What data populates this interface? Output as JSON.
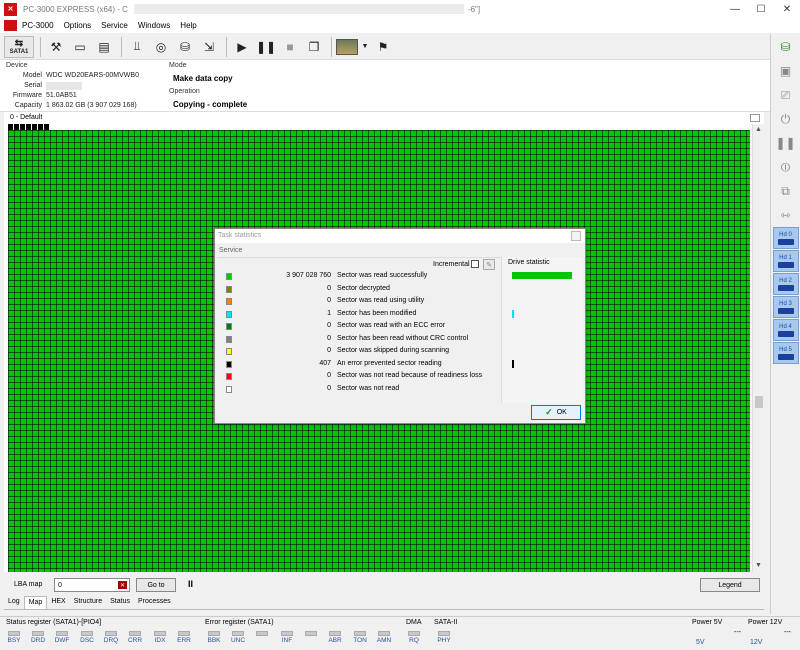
{
  "window": {
    "title": "PC-3000 EXPRESS (x64) - C",
    "title_tail": "-6\"]",
    "minimize": "—",
    "maximize": "☐",
    "close": "✕"
  },
  "menu": {
    "items": [
      "PC-3000",
      "Options",
      "Service",
      "Windows",
      "Help"
    ]
  },
  "toolbar": {
    "sata_label": "SATA1"
  },
  "device": {
    "section": "Device",
    "model_label": "Model",
    "model": "WDC WD20EARS-00MVWB0",
    "serial_label": "Serial",
    "firmware_label": "Firmware",
    "firmware": "51.0AB51",
    "capacity_label": "Capacity",
    "capacity": "1 863.02 GB (3 907 029 168)"
  },
  "mode": {
    "section": "Mode",
    "value": "Make data copy"
  },
  "operation": {
    "section": "Operation",
    "value": "Copying - complete"
  },
  "map": {
    "header": "0 - Default"
  },
  "lba": {
    "label": "LBA map",
    "value": "0",
    "goto": "Go to",
    "pause": "II",
    "legend": "Legend"
  },
  "tabs": [
    "Log",
    "Map",
    "HEX",
    "Structure",
    "Status",
    "Processes"
  ],
  "active_tab": "Map",
  "status": {
    "status_reg": "Status register (SATA1)-[PIO4]",
    "status_leds": [
      "BSY",
      "DRD",
      "DWF",
      "DSC",
      "DRQ",
      "CRR",
      "IDX",
      "ERR"
    ],
    "error_reg": "Error register (SATA1)",
    "error_leds": [
      "BBK",
      "UNC",
      "",
      "INF",
      "",
      "ABR",
      "TON",
      "AMN"
    ],
    "dma_label": "DMA",
    "dma_leds": [
      "RQ"
    ],
    "sata_label": "SATA-II",
    "sata_leds": [
      "PHY"
    ],
    "power5": "Power 5V",
    "power5_val": "5V",
    "power12": "Power 12V",
    "power12_val": "12V",
    "dash": "---"
  },
  "dialog": {
    "title": "Task statistics",
    "service": "Service",
    "incremental": "Incremental",
    "drive_statistic": "Drive statistic",
    "ok": "OK",
    "rows": [
      {
        "color": "#00c800",
        "count": "3 907 028 760",
        "desc": "Sector was read successfully"
      },
      {
        "color": "#808000",
        "count": "0",
        "desc": "Sector decrypted"
      },
      {
        "color": "#ff8000",
        "count": "0",
        "desc": "Sector was read using utility"
      },
      {
        "color": "#00e0ff",
        "count": "1",
        "desc": "Sector has been modified"
      },
      {
        "color": "#008000",
        "count": "0",
        "desc": "Sector was read with an ECC error"
      },
      {
        "color": "#808080",
        "count": "0",
        "desc": "Sector has been read without CRC control"
      },
      {
        "color": "#ffff00",
        "count": "0",
        "desc": "Sector was skipped during scanning"
      },
      {
        "color": "#000000",
        "count": "407",
        "desc": "An error prevented sector reading"
      },
      {
        "color": "#ff0000",
        "count": "0",
        "desc": "Sector was not read because of readiness loss"
      },
      {
        "color": "#ffffff",
        "count": "0",
        "desc": "Sector was not read"
      }
    ],
    "bars": [
      {
        "color": "#00c800",
        "fraction": 1.0
      },
      {
        "color": "#00e0ff",
        "fraction": 0.02
      },
      {
        "color": "#000000",
        "fraction": 0.02
      }
    ]
  },
  "sidebar": {
    "hd_labels": [
      "Hd 0",
      "Hd 1",
      "Hd 2",
      "Hd 3",
      "Hd 4",
      "Hd 5"
    ]
  }
}
